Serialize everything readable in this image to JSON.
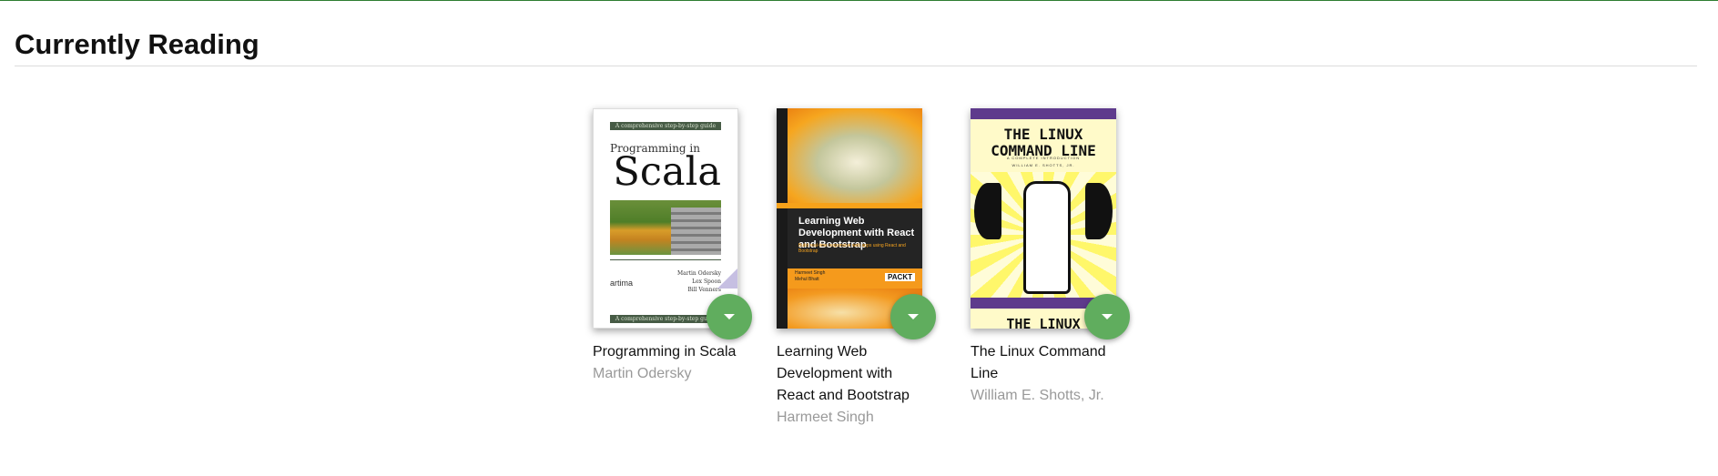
{
  "shelf": {
    "title": "Currently Reading"
  },
  "books": [
    {
      "title": "Programming in Scala",
      "author": "Martin Odersky",
      "cover": {
        "band_text": "A comprehensive step-by-step guide",
        "pre_title": "Programming in",
        "main_title": "Scala",
        "publisher": "artima",
        "authors_text": "Martin Odersky\nLex Spoon\nBill Venners"
      }
    },
    {
      "title": "Learning Web Development with React and Bootstrap",
      "author": "Harmeet Singh",
      "cover": {
        "main_title": "Learning Web Development with React and Bootstrap",
        "subtitle": "Build real-time responsive web apps using React and Bootstrap",
        "authors_text": "Harmeet Singh\nMehul Bhatt",
        "publisher": "PACKT"
      }
    },
    {
      "title": "The Linux Command Line",
      "author": "William E. Shotts, Jr.",
      "cover": {
        "main_title": "THE LINUX COMMAND LINE",
        "subtitle": "A COMPLETE INTRODUCTION",
        "author_text": "WILLIAM E. SHOTTS, JR.",
        "bottom_text": "THE LINUX"
      }
    }
  ],
  "colors": {
    "fab": "#60ad5e",
    "top_border": "#2e7d32",
    "author_text": "#999999"
  },
  "icons": {
    "fab": "caret-down-icon"
  }
}
